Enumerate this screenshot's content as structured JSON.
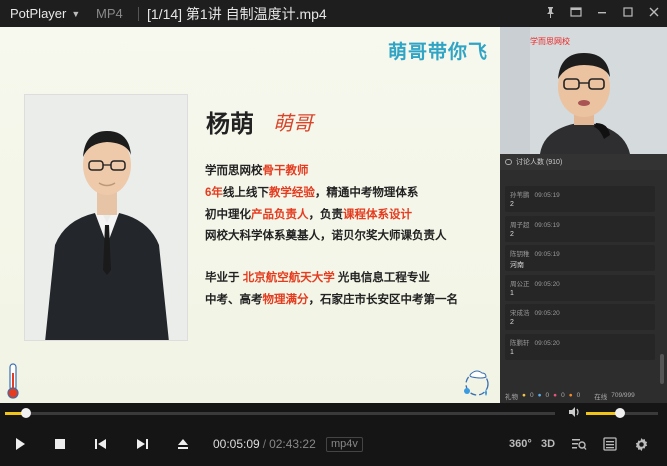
{
  "titlebar": {
    "app_name": "PotPlayer",
    "format": "MP4",
    "file_title": "[1/14] 第1讲 自制温度计.mp4"
  },
  "slide": {
    "logo_text": "萌哥带你飞",
    "teacher_name": "杨萌",
    "signature": "萌哥",
    "bio": [
      [
        {
          "t": "学而思网校",
          "h": false
        },
        {
          "t": "骨干教师",
          "h": true
        }
      ],
      [
        {
          "t": "6年",
          "h": true
        },
        {
          "t": "线上线下",
          "h": false
        },
        {
          "t": "教学经验",
          "h": true
        },
        {
          "t": "，精通中考物理体系",
          "h": false
        }
      ],
      [
        {
          "t": "初中理化",
          "h": false
        },
        {
          "t": "产品负责人",
          "h": true
        },
        {
          "t": "，负责",
          "h": false
        },
        {
          "t": "课程体系设计",
          "h": true
        }
      ],
      [
        {
          "t": "网校大科学体系奠基人，诺贝尔奖大师课负责人",
          "h": false
        }
      ],
      [
        {
          "t": "毕业于 ",
          "h": false
        },
        {
          "t": "北京航空航天大学",
          "h": true
        },
        {
          "t": " 光电信息工程专业",
          "h": false
        }
      ],
      [
        {
          "t": "中考、高考",
          "h": false
        },
        {
          "t": "物理满分",
          "h": true
        },
        {
          "t": "，石家庄市长安区中考第一名",
          "h": false
        }
      ]
    ]
  },
  "cam": {
    "badge": "学而思网校"
  },
  "chat": {
    "header": "讨论人数 (910)",
    "messages": [
      {
        "user": "孙苇鹏",
        "time": "09:05:19",
        "text": "2"
      },
      {
        "user": "周子超",
        "time": "09:05:19",
        "text": "2"
      },
      {
        "user": "陈钥稚",
        "time": "09:05:19",
        "text": "河南"
      },
      {
        "user": "周公正",
        "time": "09:05:20",
        "text": "1"
      },
      {
        "user": "宋成浩",
        "time": "09:05:20",
        "text": "2"
      },
      {
        "user": "陈鹏轩",
        "time": "09:05:20",
        "text": "1"
      }
    ],
    "footer_left": "礼物",
    "footer_counts": [
      "0",
      "0",
      "0",
      "0"
    ],
    "footer_right_label": "在线",
    "footer_right_value": "709/999"
  },
  "player": {
    "current_time": "00:05:09",
    "total_time": "02:43:22",
    "codec": "mp4v",
    "progress_fraction": 0.0382,
    "volume_fraction": 0.47,
    "btn_360": "360°",
    "btn_3d": "3D"
  },
  "icons": {
    "play": "play-icon",
    "stop": "stop-icon",
    "prev": "previous-icon",
    "next": "next-icon",
    "eject": "eject-icon",
    "volume": "volume-icon",
    "playlist": "playlist-icon",
    "chapters": "chapter-search-icon",
    "settings": "gear-icon",
    "pin": "pin-icon"
  },
  "colors": {
    "accent": "#f0c419",
    "highlight": "#e53b1e",
    "logo": "#2fa4c5"
  }
}
